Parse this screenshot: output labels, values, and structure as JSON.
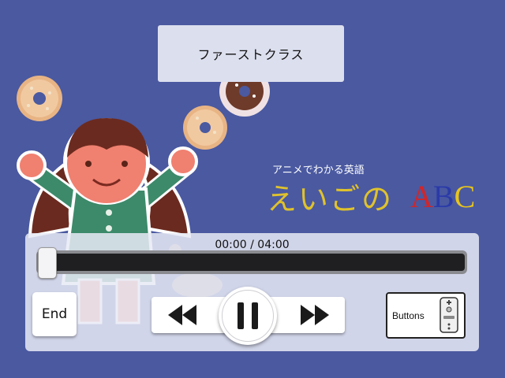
{
  "title": "ファーストクラス",
  "logo": {
    "subtitle": "アニメでわかる英語",
    "kana": "えいごの",
    "abc": [
      "A",
      "B",
      "C"
    ]
  },
  "player": {
    "time": "00:00 / 04:00",
    "progress": 0,
    "end_label": "End",
    "buttons_label": "Buttons"
  },
  "icons": {
    "rewind": "rewind-icon",
    "pause": "pause-icon",
    "fast_forward": "fast-forward-icon",
    "remote": "wii-remote-icon"
  },
  "colors": {
    "background": "#4a59a0",
    "logo_kana": "#e0c22c",
    "logo_a": "#d0262a",
    "logo_b": "#2a3aa8",
    "logo_c": "#e8c41c"
  }
}
